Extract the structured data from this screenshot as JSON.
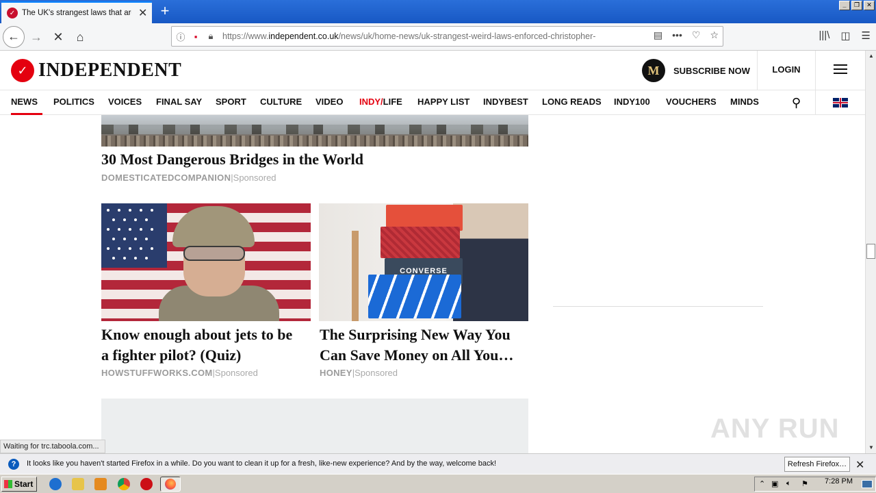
{
  "browser": {
    "tab_title": "The UK's strangest laws that are s",
    "url_prefix": "https://www.",
    "url_domain": "independent.co.uk",
    "url_path": "/news/uk/home-news/uk-strangest-weird-laws-enforced-christopher-"
  },
  "site": {
    "logo_text": "INDEPENDENT",
    "subscribe_label": "SUBSCRIBE NOW",
    "subscribe_badge": "M",
    "login_label": "LOGIN",
    "sections": [
      "NEWS",
      "POLITICS",
      "VOICES",
      "FINAL SAY",
      "SPORT",
      "CULTURE",
      "VIDEO",
      "INDY/",
      "LIFE",
      "HAPPY LIST",
      "INDYBEST",
      "LONG READS",
      "INDY100",
      "VOUCHERS",
      "MINDS"
    ],
    "accent_color": "#e4000f"
  },
  "articles": [
    {
      "headline": "30 Most Dangerous Bridges in the World",
      "source": "DOMESTICATEDCOMPANION",
      "sponsored": "Sponsored"
    },
    {
      "headline_line1": "Know enough about jets to be",
      "headline_line2": "a fighter pilot? (Quiz)",
      "source": "HOWSTUFFWORKS.COM",
      "sponsored": "Sponsored"
    },
    {
      "headline_line1": "The Surprising New Way You",
      "headline_line2": "Can Save Money on All You…",
      "source": "HONEY",
      "sponsored": "Sponsored",
      "box_label": "CONVERSE"
    }
  ],
  "status_text": "Waiting for trc.taboola.com...",
  "watermark": "ANY RUN",
  "notification": {
    "message": "It looks like you haven't started Firefox in a while. Do you want to clean it up for a fresh, like-new experience? And by the way, welcome back!",
    "button_label": "Refresh Firefox…"
  },
  "taskbar": {
    "start_label": "Start",
    "clock": "7:28 PM"
  }
}
